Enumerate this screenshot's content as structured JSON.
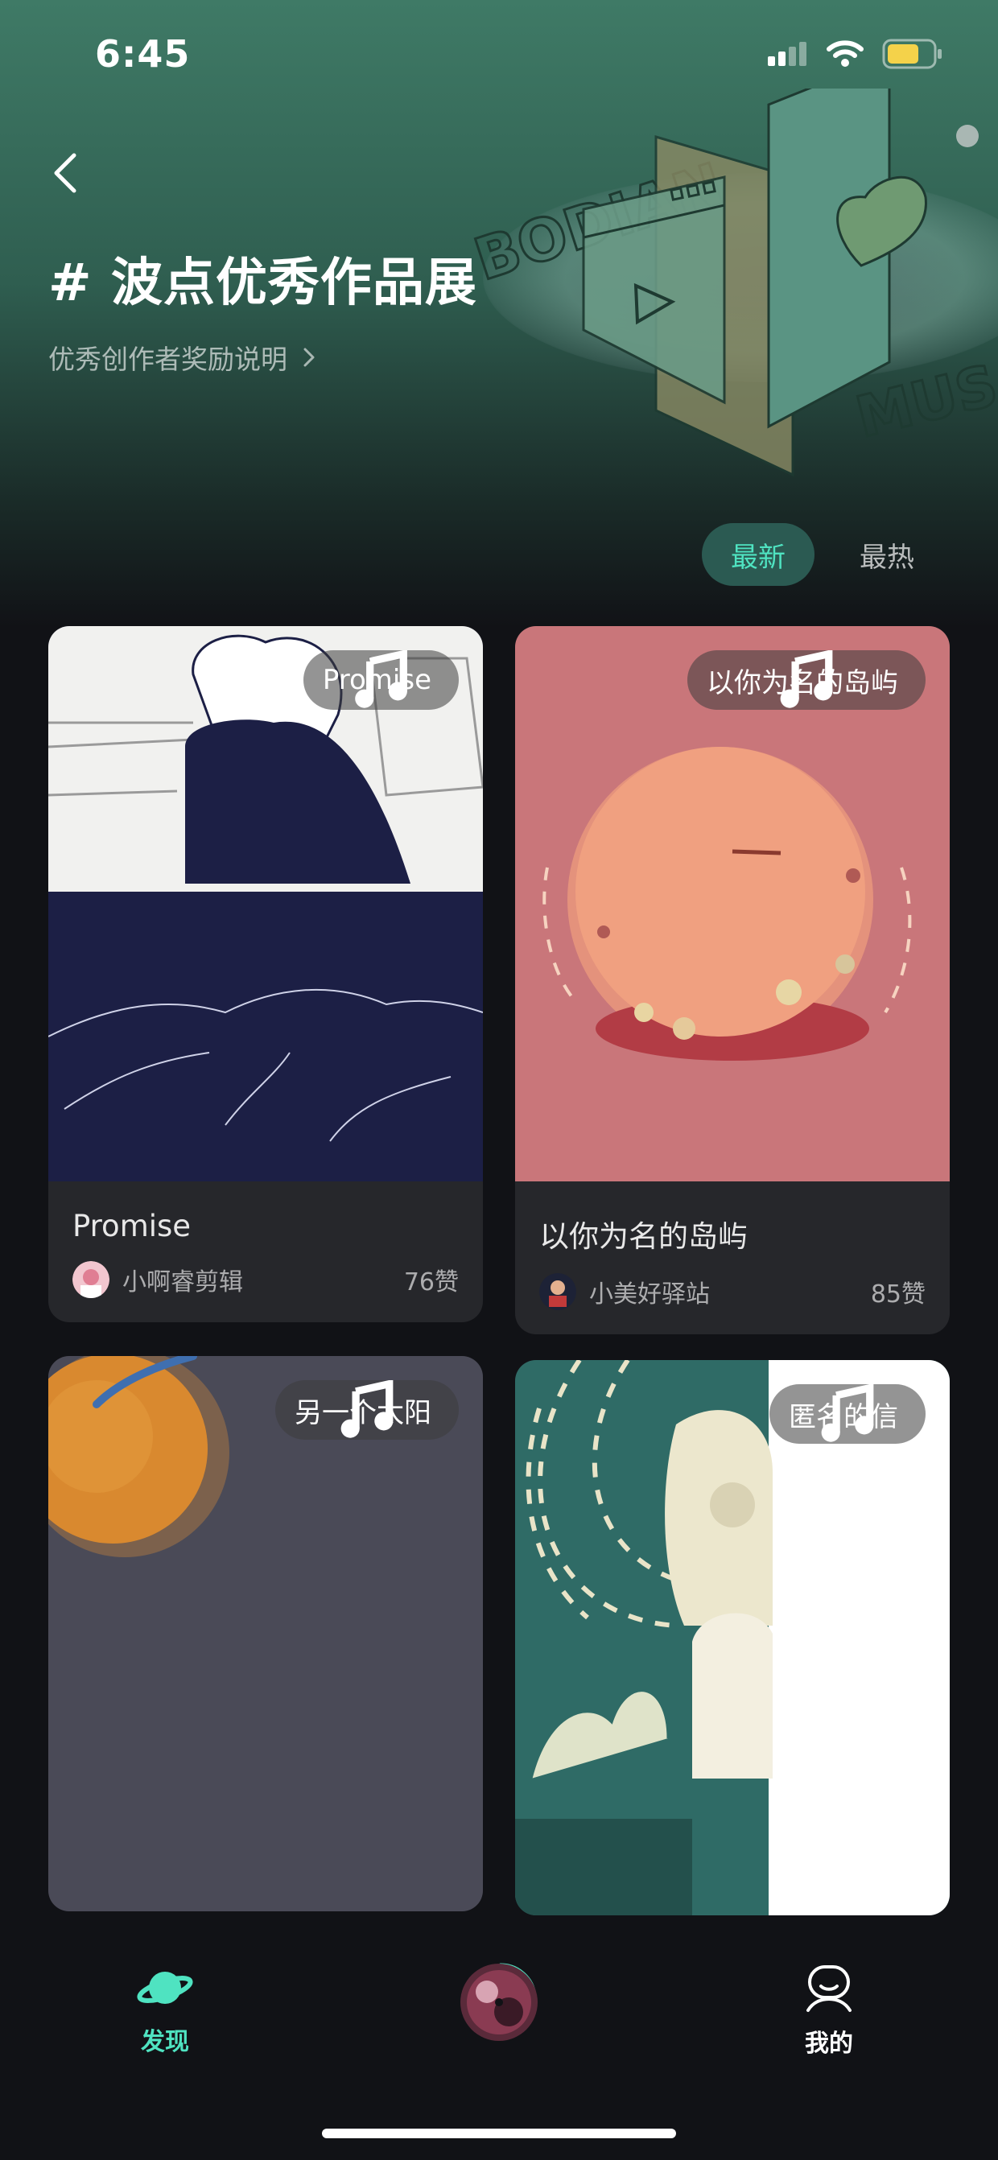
{
  "status": {
    "time": "6:45"
  },
  "header": {
    "title": "# 波点优秀作品展",
    "subtitle": "优秀创作者奖励说明",
    "deco_text_left": "BODIAN",
    "deco_text_right": "MUS"
  },
  "sort_tabs": [
    {
      "label": "最新",
      "active": true
    },
    {
      "label": "最热",
      "active": false
    }
  ],
  "cards": [
    {
      "tag": "Promise",
      "title": "Promise",
      "author": "小啊睿剪辑",
      "likes": "76赞"
    },
    {
      "tag": "以你为名的岛屿",
      "title": "以你为名的岛屿",
      "author": "小美好驿站",
      "likes": "85赞"
    },
    {
      "tag": "另一个太阳"
    },
    {
      "tag": "匿名的信"
    }
  ],
  "tab_bar": {
    "discover": "发现",
    "mine": "我的"
  },
  "colors": {
    "accent": "#4fe3c1",
    "header_green": "#3f7a66",
    "background": "#111216",
    "card": "#26272b"
  }
}
